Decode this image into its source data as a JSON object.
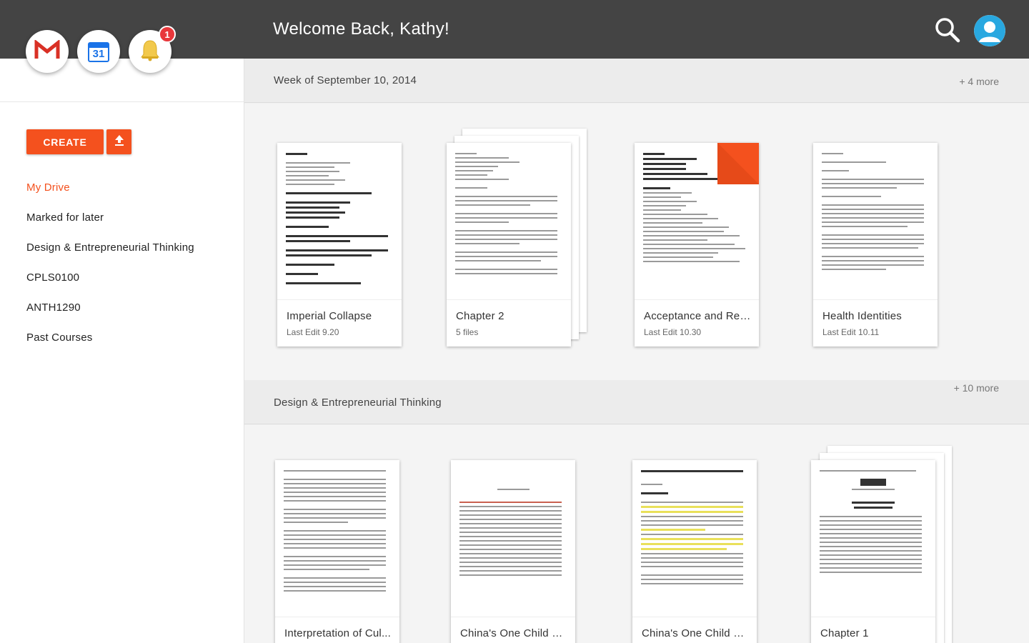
{
  "header": {
    "welcome": "Welcome Back, Kathy!"
  },
  "apps": {
    "gmail_letter": "M",
    "calendar_date": "31",
    "notification_count": "1"
  },
  "sidebar": {
    "create_label": "CREATE",
    "items": [
      {
        "label": "My Drive",
        "active": true
      },
      {
        "label": "Marked for later",
        "active": false
      },
      {
        "label": "Design & Entrepreneurial Thinking",
        "active": false
      },
      {
        "label": "CPLS0100",
        "active": false
      },
      {
        "label": "ANTH1290",
        "active": false
      },
      {
        "label": "Past Courses",
        "active": false
      }
    ]
  },
  "sections": [
    {
      "title": "Week of September 10, 2014",
      "more": "+ 4 more",
      "cards": [
        {
          "name": "Imperial Collapse",
          "sub": "Last Edit 9.20"
        },
        {
          "name": "Chapter 2",
          "sub": "5 files"
        },
        {
          "name": "Acceptance and Reje...",
          "sub": "Last Edit 10.30"
        },
        {
          "name": "Health Identities",
          "sub": "Last Edit 10.11"
        }
      ]
    },
    {
      "title": "Design & Entrepreneurial Thinking",
      "more": "+ 10 more",
      "cards": [
        {
          "name": "Interpretation of Cul...",
          "sub": ""
        },
        {
          "name": "China's One Child Po...",
          "sub": ""
        },
        {
          "name": "China's One Child Po...",
          "sub": ""
        },
        {
          "name": "Chapter 1",
          "sub": ""
        }
      ]
    }
  ],
  "colors": {
    "accent": "#f4511e",
    "topbar": "#444444",
    "badge": "#e8373b"
  }
}
